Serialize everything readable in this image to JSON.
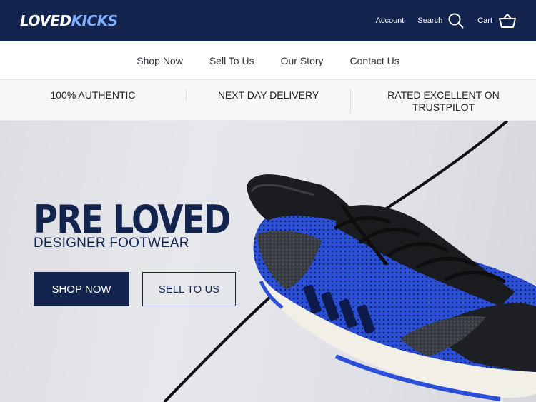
{
  "header": {
    "logo_part1": "LOVED",
    "logo_part2": "KICKS",
    "account_label": "Account",
    "search_label": "Search",
    "cart_label": "Cart",
    "icons": [
      "search-icon",
      "basket-icon"
    ]
  },
  "nav": {
    "items": [
      {
        "label": "Shop Now"
      },
      {
        "label": "Sell To Us"
      },
      {
        "label": "Our Story"
      },
      {
        "label": "Contact Us"
      }
    ]
  },
  "usp": {
    "items": [
      {
        "label": "100% AUTHENTIC"
      },
      {
        "label": "NEXT DAY DELIVERY"
      },
      {
        "label": "RATED EXCELLENT ON TRUSTPILOT"
      }
    ]
  },
  "hero": {
    "title": "PRE LOVED",
    "subtitle": "DESIGNER FOOTWEAR",
    "primary_button": "SHOP NOW",
    "secondary_button": "SELL TO US"
  },
  "colors": {
    "brand_navy": "#13254f",
    "logo_accent": "#7fb0ff",
    "shoe_blue": "#2b4fd6"
  }
}
